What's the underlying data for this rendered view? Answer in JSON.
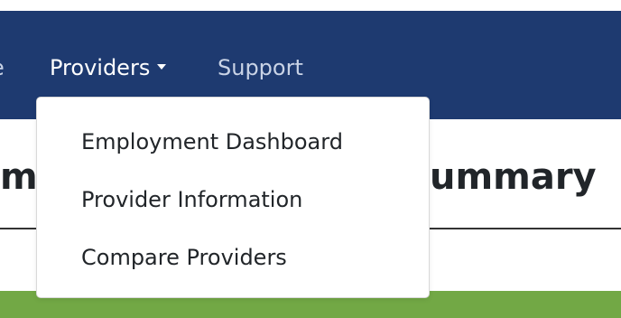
{
  "navbar": {
    "partial_item": "e",
    "providers_label": "Providers",
    "support_label": "Support"
  },
  "dropdown": {
    "items": [
      {
        "label": "Employment Dashboard"
      },
      {
        "label": "Provider Information"
      },
      {
        "label": "Compare Providers"
      }
    ]
  },
  "page": {
    "title_left": "m",
    "title_right": "ummary"
  },
  "colors": {
    "navbar_bg": "#1e3a70",
    "accent_green": "#72a845"
  }
}
